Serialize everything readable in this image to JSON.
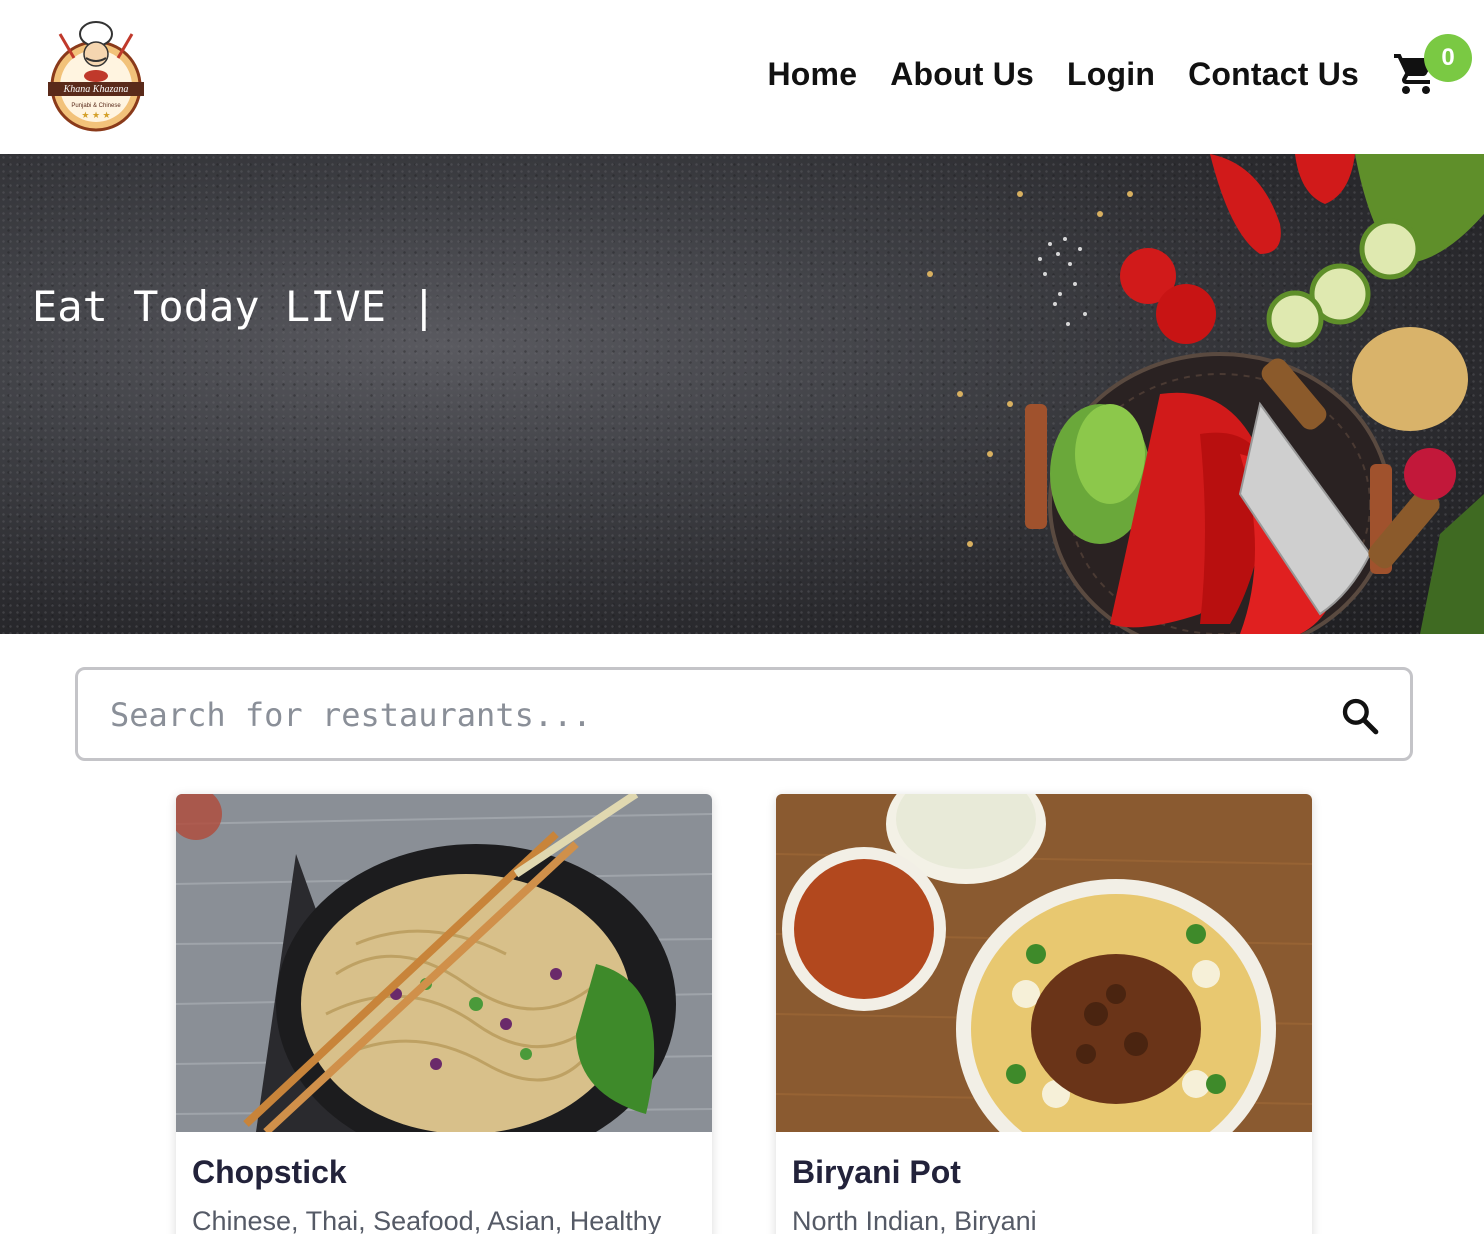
{
  "brand": {
    "logo_text": "Khana Khazana",
    "logo_subtext": "Punjabi & Chinese"
  },
  "nav": {
    "items": [
      "Home",
      "About Us",
      "Login",
      "Contact Us"
    ]
  },
  "cart": {
    "count": "0",
    "icon": "cart-icon"
  },
  "hero": {
    "title": "Eat Today LIVE |"
  },
  "search": {
    "placeholder": "Search for restaurants...",
    "value": "",
    "icon": "search-icon"
  },
  "restaurants": [
    {
      "name": "Chopstick",
      "cuisines": "Chinese, Thai, Seafood, Asian, Healthy"
    },
    {
      "name": "Biryani Pot",
      "cuisines": "North Indian, Biryani"
    }
  ],
  "colors": {
    "accent": "#7ac943",
    "text": "#111111",
    "card_title": "#22223a",
    "muted": "#555a66"
  }
}
